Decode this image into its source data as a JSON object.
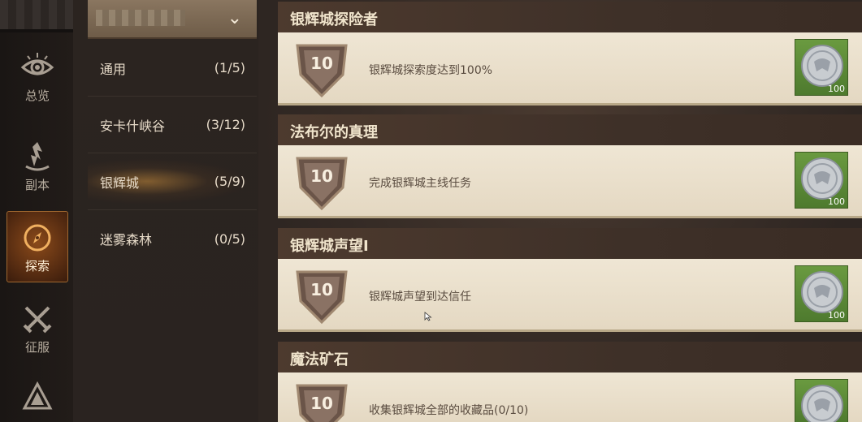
{
  "rail": {
    "items": [
      {
        "label": "总览",
        "icon": "eye-icon"
      },
      {
        "label": "副本",
        "icon": "flame-icon"
      },
      {
        "label": "探索",
        "icon": "compass-icon"
      },
      {
        "label": "征服",
        "icon": "crossed-swords-icon"
      },
      {
        "label": "",
        "icon": "triangle-emblem-icon"
      }
    ],
    "active_index": 2
  },
  "categories": [
    {
      "name": "通用",
      "progress": "(1/5)"
    },
    {
      "name": "安卡什峡谷",
      "progress": "(3/12)"
    },
    {
      "name": "银辉城",
      "progress": "(5/9)"
    },
    {
      "name": "迷雾森林",
      "progress": "(0/5)"
    }
  ],
  "achievements": [
    {
      "title": "银辉城探险者",
      "points": "10",
      "description": "银辉城探索度达到100%",
      "reward_qty": "100"
    },
    {
      "title": "法布尔的真理",
      "points": "10",
      "description": "完成银辉城主线任务",
      "reward_qty": "100"
    },
    {
      "title": "银辉城声望I",
      "points": "10",
      "description": "银辉城声望到达信任",
      "reward_qty": "100"
    },
    {
      "title": "魔法矿石",
      "points": "10",
      "description": "收集银辉城全部的收藏品(0/10)",
      "reward_qty": ""
    }
  ],
  "colors": {
    "accent": "#8a4a1a",
    "reward_bg": "#5a8a36",
    "card_bg": "#efe6d4"
  }
}
